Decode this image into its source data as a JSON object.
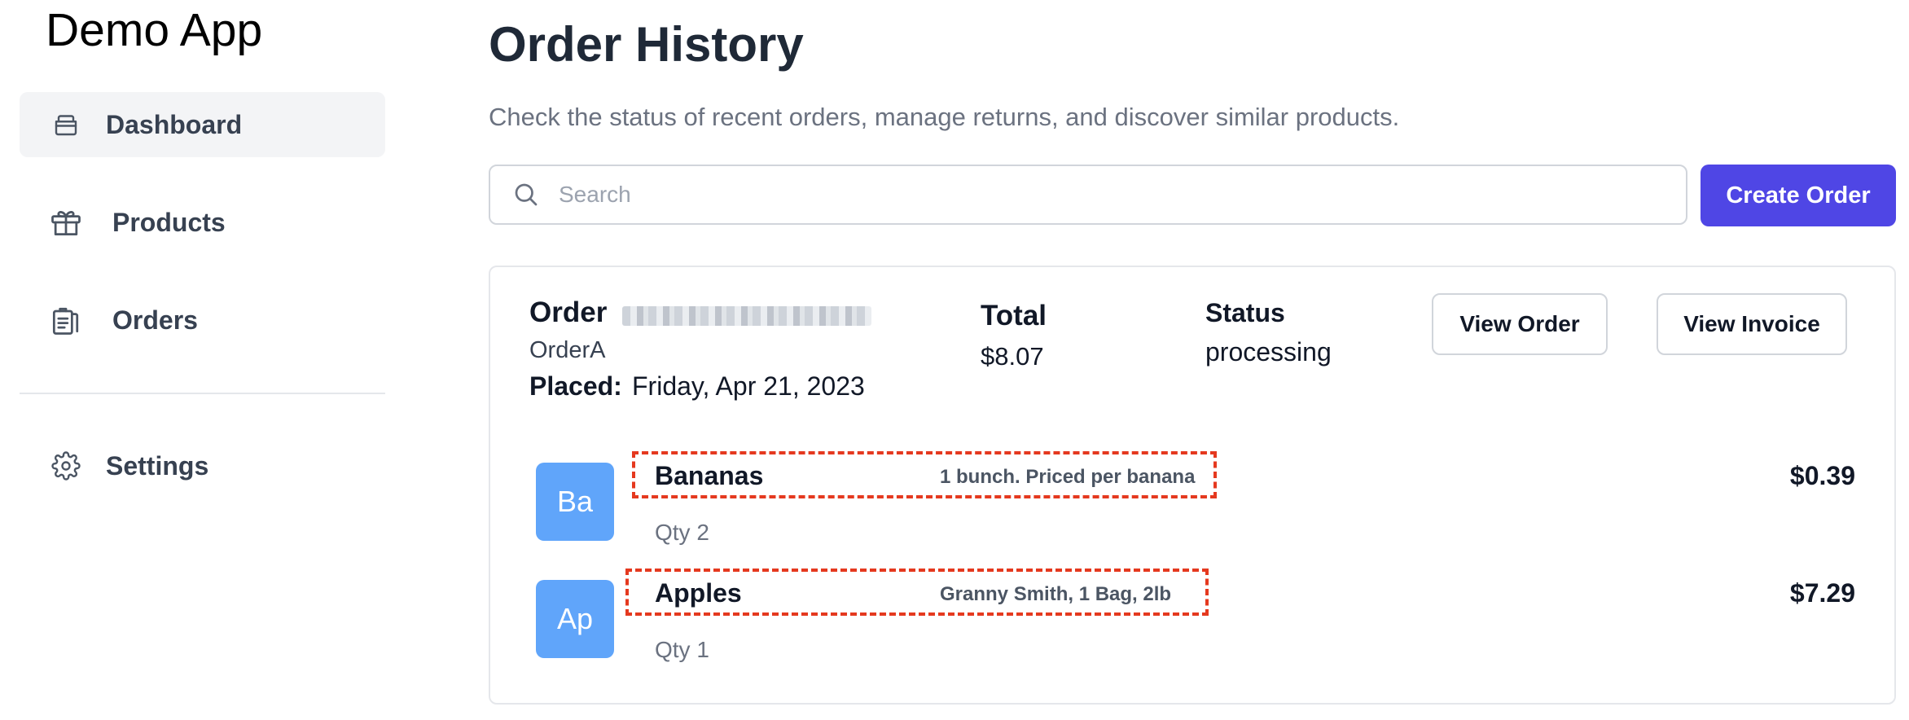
{
  "sidebar": {
    "app_title": "Demo App",
    "items": [
      {
        "label": "Dashboard",
        "icon": "dashboard-icon",
        "active": true
      },
      {
        "label": "Products",
        "icon": "gift-icon",
        "active": false
      },
      {
        "label": "Orders",
        "icon": "clipboard-icon",
        "active": false
      }
    ],
    "settings": {
      "label": "Settings",
      "icon": "gear-icon"
    }
  },
  "header": {
    "title": "Order History",
    "subtitle": "Check the status of recent orders, manage returns, and discover similar products."
  },
  "search": {
    "placeholder": "Search",
    "value": ""
  },
  "actions": {
    "create_order_label": "Create Order"
  },
  "order": {
    "order_label": "Order",
    "name": "OrderA",
    "placed_label": "Placed:",
    "placed_date": "Friday, Apr 21, 2023",
    "total_label": "Total",
    "total_value": "$8.07",
    "status_label": "Status",
    "status_value": "processing",
    "view_order_label": "View Order",
    "view_invoice_label": "View Invoice",
    "items": [
      {
        "initials": "Ba",
        "name": "Bananas",
        "description": "1 bunch. Priced per banana",
        "qty": "Qty 2",
        "price": "$0.39"
      },
      {
        "initials": "Ap",
        "name": "Apples",
        "description": "Granny Smith, 1 Bag, 2lb",
        "qty": "Qty 1",
        "price": "$7.29"
      }
    ]
  },
  "colors": {
    "accent": "#4f46e5",
    "avatar": "#60a5fa",
    "highlight_dash": "#e5391f",
    "active_nav_bg": "#f3f4f6"
  }
}
